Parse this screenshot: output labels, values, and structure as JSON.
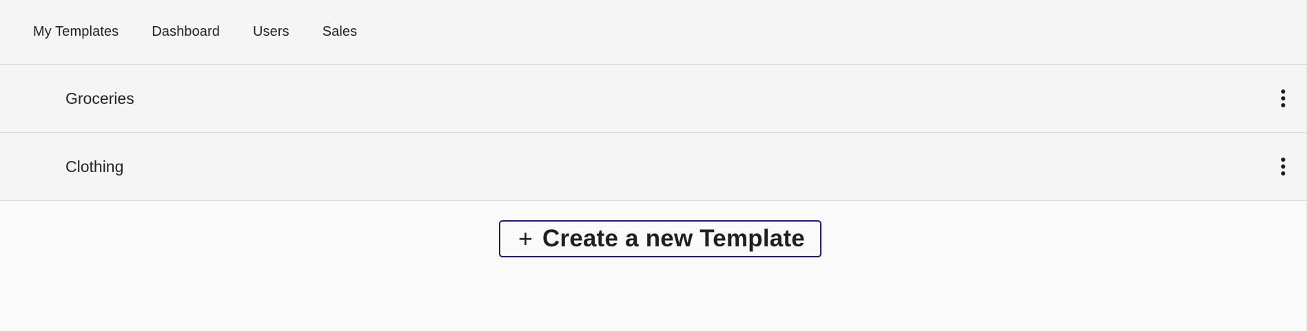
{
  "nav": {
    "items": [
      {
        "label": "My Templates"
      },
      {
        "label": "Dashboard"
      },
      {
        "label": "Users"
      },
      {
        "label": "Sales"
      }
    ]
  },
  "templates": [
    {
      "name": "Groceries",
      "menu_icon": "more-vertical-icon"
    },
    {
      "name": "Clothing",
      "menu_icon": "more-vertical-icon"
    }
  ],
  "create_button": {
    "icon": "plus-icon",
    "icon_glyph": "+",
    "label": "Create a new Template",
    "border_color": "#1a1a7a"
  }
}
